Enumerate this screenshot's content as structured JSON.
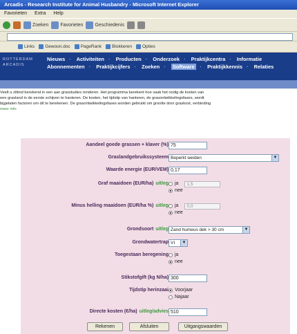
{
  "window": {
    "title": "Arcadis - Research Institute for Animal Husbandry - Microsoft Internet Explorer"
  },
  "menubar": {
    "items": [
      "Favorieten",
      "Extra",
      "Help"
    ]
  },
  "toolbar": {
    "items": [
      "Zoeken",
      "Favorieten",
      "Geschiedenis"
    ]
  },
  "addressbar": {
    "value": ""
  },
  "linksbar": {
    "items": [
      "Links",
      "Gewoon.doc",
      "PageRank",
      "Blokkeren",
      "Opties"
    ]
  },
  "site": {
    "brand_text": "ROTTERDAM ARCADIS",
    "nav_row1": [
      "Nieuws",
      "Activiteiten",
      "Producten",
      "Onderzoek",
      "Praktijkcentra",
      "Informatie"
    ],
    "nav_row2": [
      "Abonnementen",
      "Praktijkcijfers",
      "Zoeken",
      "Software",
      "Praktijkkennis",
      "Relaties"
    ],
    "nav_selected": "Software"
  },
  "intro": {
    "line1": "Veelt u zittind berekend in een aan grasstudies renderen. Het programma berekent hoe vaak het nodig de kosten van",
    "line2": "een grasland in de eerste schijven te hanteren. De kosten, het tijdstip van hanteren, de grasontwikkelingsfases, wordt",
    "line3": "bijgelaten factoren om dit te berekenen. De grasontwikkelingsfases worden gebruikt om grootte door graskost, verbinding",
    "more": "meer info"
  },
  "form": {
    "field1": {
      "label": "Aandeel goede grassen + klaver (%)",
      "value": "75"
    },
    "field2": {
      "label": "Graslandgebruikssysteem",
      "value": "Beperkt weiden"
    },
    "field3": {
      "label": "Waarde energie (EUR/VEM)",
      "value": "0,17"
    },
    "field4": {
      "label": "Graf maaidoen (EUR/ha)",
      "uitleg": "uitleg",
      "opt_yes": "ja",
      "opt_no": "nee",
      "value": "1,5"
    },
    "field5": {
      "label": "Minus helling maaidoen (EUR/ha %)",
      "uitleg": "uitleg",
      "opt_yes": "ja",
      "opt_no": "nee",
      "value": "0,0"
    },
    "field6": {
      "label": "Grondsoort",
      "uitleg": "uitleg",
      "value": "Zand humeus dek > 30 cm"
    },
    "field7": {
      "label": "Grondwatertrap",
      "value": "VI"
    },
    "field8": {
      "label": "Toegestaan beregening",
      "opt_yes": "ja",
      "opt_no": "nee"
    },
    "field9": {
      "label": "Stikstofgift (kg N/ha)",
      "value": "300"
    },
    "field10": {
      "label": "Tijdstip herinzaai",
      "opt1": "Voorjaar",
      "opt2": "Najaar"
    },
    "field11": {
      "label": "Directe kosten (€/ha)",
      "uitleg": "uitleg/advies",
      "value": "510"
    }
  },
  "buttons": {
    "calculate": "Rekenen",
    "reset": "Afsluiten",
    "defaults": "Uitgangswaarden"
  }
}
